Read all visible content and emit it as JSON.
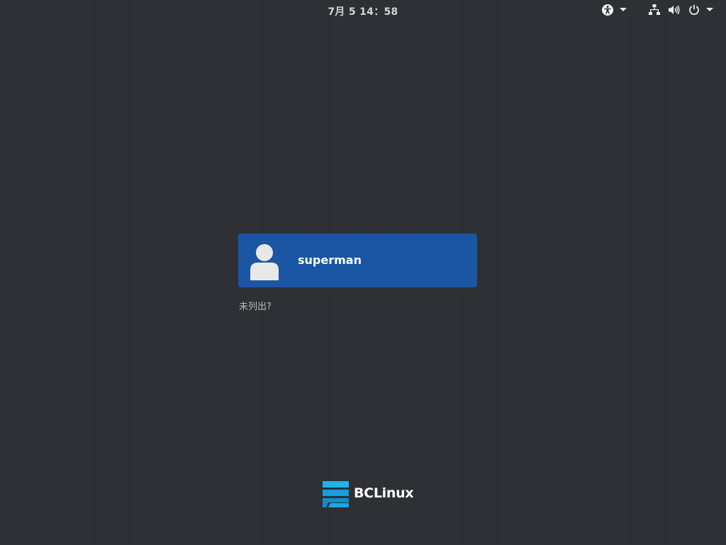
{
  "topbar": {
    "clock": "7月 5  14：58",
    "icons": {
      "accessibility": "accessibility-icon",
      "network": "network-wired-icon",
      "volume": "volume-icon",
      "power": "power-icon",
      "dropdown": "chevron-down-icon"
    }
  },
  "login": {
    "users": [
      {
        "name": "superman",
        "avatar": "user-avatar-icon"
      }
    ],
    "not_listed_label": "未列出?"
  },
  "branding": {
    "logo_text": "BCLinux",
    "logo_color": "#18a6e8"
  },
  "colors": {
    "background": "#2d3034",
    "user_card": "#1a56a3"
  }
}
